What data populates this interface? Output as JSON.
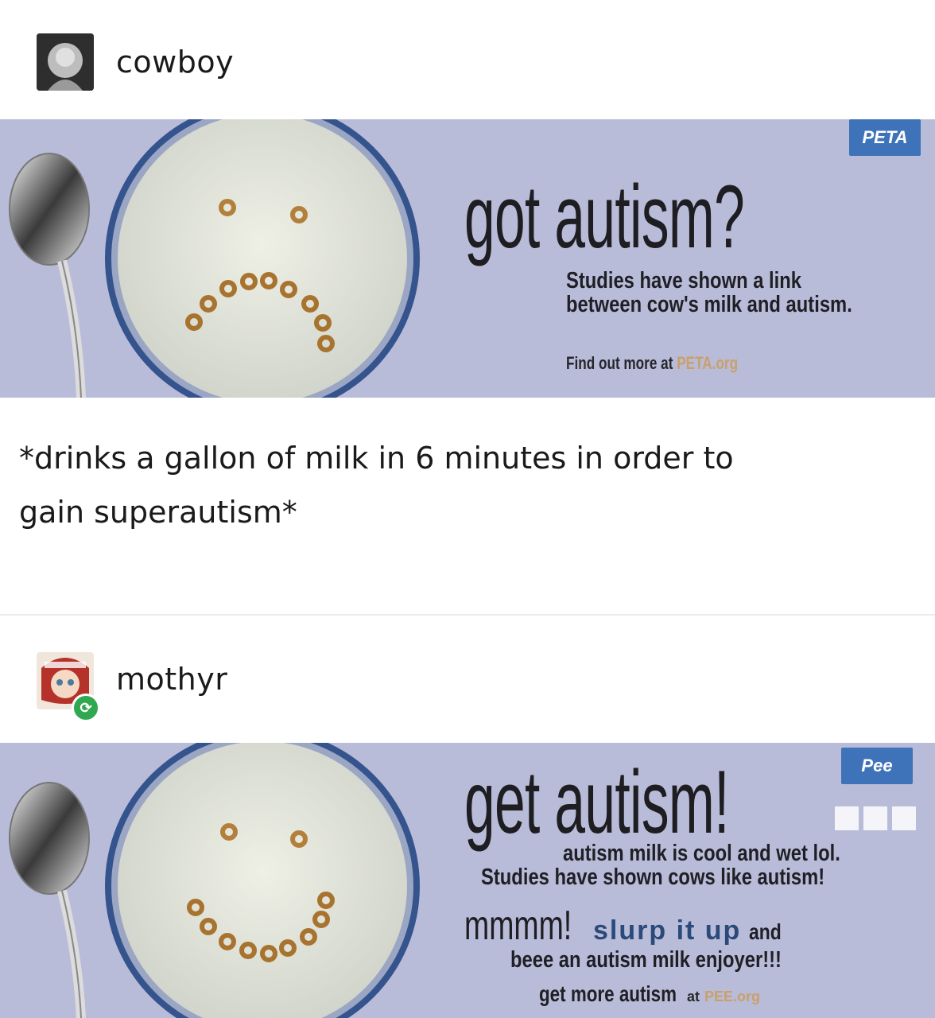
{
  "post1": {
    "username": "cowboy",
    "ad": {
      "badge": "PETA",
      "headline": "got autism?",
      "body_line1": "Studies have shown a link",
      "body_line2": "between cow's milk and autism.",
      "footer_prefix": "Find out more at",
      "footer_link": "PETA.org",
      "mood": "sad"
    },
    "caption_line1": "*drinks a gallon of milk in 6 minutes in order to",
    "caption_line2": "gain superautism*"
  },
  "post2": {
    "username": "mothyr",
    "reblog_icon": "reblog-icon",
    "ad": {
      "badge": "Pee",
      "headline": "get autism!",
      "line1": "autism milk is cool and wet lol.",
      "line2": "Studies have shown cows like autism!",
      "line3_a": "mmmm!",
      "line3_b": "slurp it up",
      "line3_c": "and",
      "line4": "beee an autism milk enjoyer!!!",
      "footer_a": "get more autism",
      "footer_b": "at",
      "footer_link": "PEE.org",
      "mood": "happy"
    }
  },
  "colors": {
    "ad_background": "#b9bcd8",
    "badge_blue": "#3f73b9",
    "link_tan": "#c9a06a",
    "reblog_green": "#2fa84f"
  }
}
